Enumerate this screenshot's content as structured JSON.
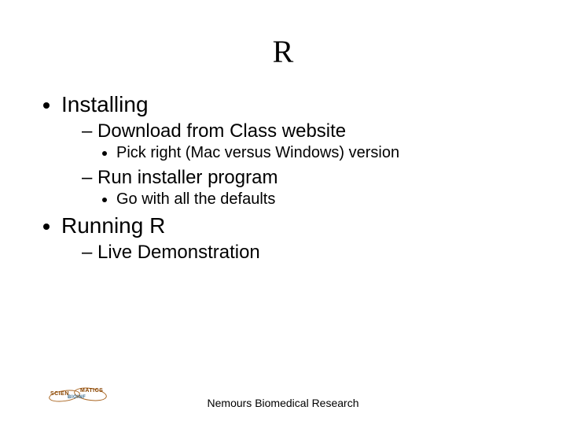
{
  "title": "R",
  "bullets": {
    "item1": {
      "label": "Installing",
      "sub1": {
        "label": "Download from Class website",
        "subsub1": "Pick right (Mac versus Windows) version"
      },
      "sub2": {
        "label": "Run installer program",
        "subsub1": "Go with all the defaults"
      }
    },
    "item2": {
      "label": "Running R",
      "sub1": {
        "label": "Live Demonstration"
      }
    }
  },
  "footer": "Nemours Biomedical Research",
  "logo": {
    "text_left": "SCIEN",
    "text_mid": "BIOINF",
    "text_right": "MATICS"
  }
}
